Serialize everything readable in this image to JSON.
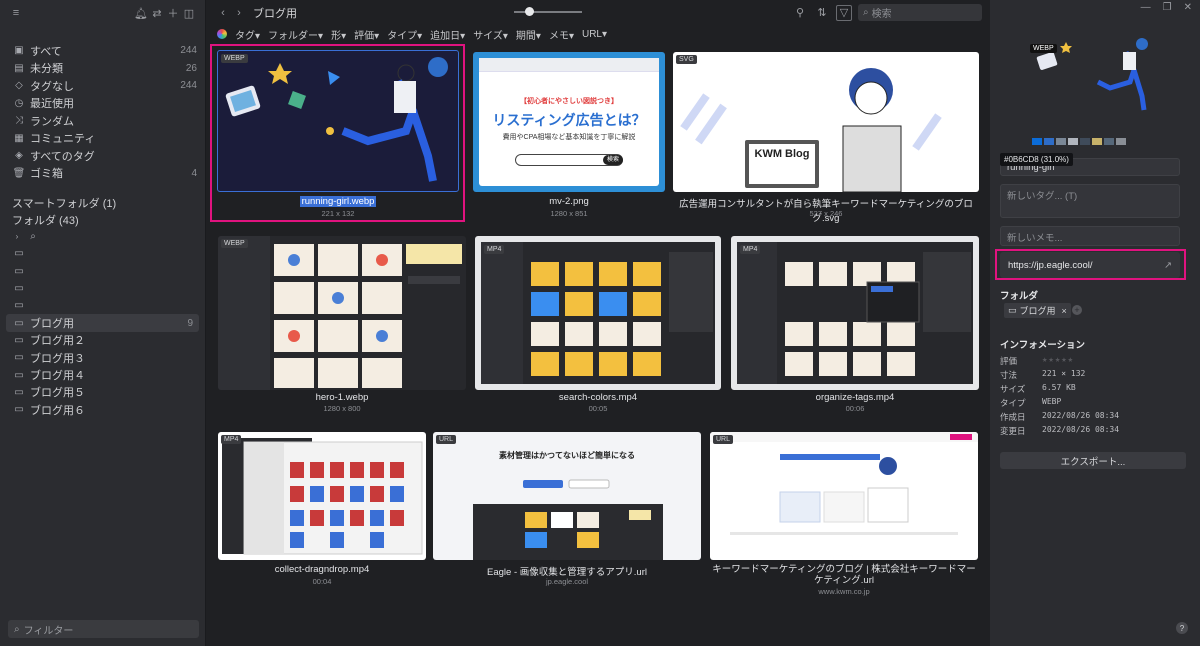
{
  "sidebar": {
    "nav": [
      {
        "label": "すべて",
        "count": "244",
        "icon": "all-icon"
      },
      {
        "label": "未分類",
        "count": "26",
        "icon": "unsorted-icon"
      },
      {
        "label": "タグなし",
        "count": "244",
        "icon": "untagged-icon"
      },
      {
        "label": "最近使用",
        "count": "",
        "icon": "recent-icon"
      },
      {
        "label": "ランダム",
        "count": "",
        "icon": "random-icon"
      },
      {
        "label": "コミュニティ",
        "count": "",
        "icon": "community-icon"
      },
      {
        "label": "すべてのタグ",
        "count": "",
        "icon": "tags-icon"
      },
      {
        "label": "ゴミ箱",
        "count": "4",
        "icon": "trash-icon"
      }
    ],
    "smart_folders": "スマートフォルダ (1)",
    "folders_title": "フォルダ (43)",
    "folders": [
      {
        "label": "",
        "count": ""
      },
      {
        "label": "",
        "count": ""
      },
      {
        "label": "",
        "count": ""
      },
      {
        "label": "",
        "count": ""
      },
      {
        "label": "ブログ用",
        "count": "9"
      },
      {
        "label": "ブログ用２",
        "count": ""
      },
      {
        "label": "ブログ用３",
        "count": ""
      },
      {
        "label": "ブログ用４",
        "count": ""
      },
      {
        "label": "ブログ用５",
        "count": ""
      },
      {
        "label": "ブログ用６",
        "count": ""
      }
    ],
    "filter_placeholder": "フィルター"
  },
  "toolbar": {
    "breadcrumb": "ブログ用",
    "search_placeholder": "検索"
  },
  "filters": [
    "タグ",
    "フォルダー",
    "形",
    "評価",
    "タイプ",
    "追加日",
    "サイズ",
    "期間",
    "メモ",
    "URL"
  ],
  "items": [
    {
      "name": "running-girl.webp",
      "sub": "221 x 132",
      "badge": "WEBP"
    },
    {
      "name": "mv-2.png",
      "sub": "1280 x 851",
      "badge": ""
    },
    {
      "name": "広告運用コンサルタントが自ら執筆キーワードマーケティングのブログ.svg",
      "sub": "527 x 246",
      "badge": "SVG"
    },
    {
      "name": "hero-1.webp",
      "sub": "1280 x 800",
      "badge": "WEBP"
    },
    {
      "name": "search-colors.mp4",
      "sub": "00:05",
      "badge": "MP4"
    },
    {
      "name": "organize-tags.mp4",
      "sub": "00:06",
      "badge": "MP4"
    },
    {
      "name": "collect-dragndrop.mp4",
      "sub": "00:04",
      "badge": "MP4"
    },
    {
      "name": "Eagle - 画像収集と管理するアプリ.url",
      "sub": "jp.eagle.cool",
      "badge": "URL"
    },
    {
      "name": "キーワードマーケティングのブログ | 株式会社キーワードマーケティング.url",
      "sub": "www.kwm.co.jp",
      "badge": "URL"
    }
  ],
  "mv2": {
    "tag": "【初心者にやさしい図説つき】",
    "title": "リスティング広告とは？",
    "subtitle": "費用やCPA相場など基本知識を丁寧に解説",
    "btn": "検索"
  },
  "kwm_blog": "KWM Blog",
  "eagle_hero": "素材管理はかつてないほど簡単になる",
  "panel": {
    "tooltip": "#0B6CD8 (31.0%)",
    "name_value": "running-girl",
    "tag_placeholder": "新しいタグ... (T)",
    "memo_placeholder": "新しいメモ...",
    "url_value": "https://jp.eagle.cool/",
    "folder_title": "フォルダ",
    "folder_chip": "ブログ用",
    "info_title": "インフォメーション",
    "info": [
      {
        "k": "評価",
        "v": "★★★★★"
      },
      {
        "k": "寸法",
        "v": "221 × 132"
      },
      {
        "k": "サイズ",
        "v": "6.57 KB"
      },
      {
        "k": "タイプ",
        "v": "WEBP"
      },
      {
        "k": "作成日",
        "v": "2022/08/26 08:34"
      },
      {
        "k": "変更日",
        "v": "2022/08/26 08:34"
      }
    ],
    "export_label": "エクスポート...",
    "palette": [
      "#0b6cd8",
      "#2e6dc8",
      "#7a8796",
      "#b0b5bd",
      "#3f4b5a",
      "#c7b26a",
      "#56687a",
      "#8a8f96"
    ]
  },
  "colors": {
    "highlight": "#e0137f",
    "selected_label": "#3a6fd6"
  }
}
